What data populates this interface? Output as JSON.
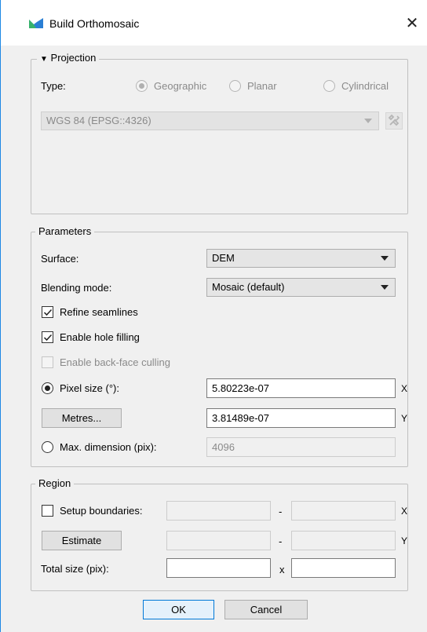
{
  "window": {
    "title": "Build Orthomosaic",
    "close_symbol": "✕",
    "accent": "#1e88e5"
  },
  "projection": {
    "group_title": "Projection",
    "collapse_symbol": "▼",
    "type_label": "Type:",
    "options": [
      "Geographic",
      "Planar",
      "Cylindrical"
    ],
    "selected": "Geographic",
    "crs_value": "WGS 84 (EPSG::4326)",
    "crs_tool_icon": "wrench-screwdriver-icon"
  },
  "parameters": {
    "group_title": "Parameters",
    "surface_label": "Surface:",
    "surface_value": "DEM",
    "blending_label": "Blending mode:",
    "blending_value": "Mosaic (default)",
    "refine_seamlines": {
      "label": "Refine seamlines",
      "checked": true
    },
    "hole_filling": {
      "label": "Enable hole filling",
      "checked": true
    },
    "back_face_culling": {
      "label": "Enable back-face culling",
      "checked": false,
      "enabled": false
    },
    "pixel_size_label": "Pixel size (°):",
    "pixel_size_x": "5.80223e-07",
    "pixel_size_y": "3.81489e-07",
    "metres_button": "Metres...",
    "max_dimension_label": "Max. dimension (pix):",
    "max_dimension_value": "4096",
    "axis_x": "X",
    "axis_y": "Y"
  },
  "region": {
    "group_title": "Region",
    "setup_boundaries_label": "Setup boundaries:",
    "estimate_button": "Estimate",
    "dash": "-",
    "total_size_label": "Total size (pix):",
    "times": "x",
    "axis_x": "X",
    "axis_y": "Y"
  },
  "footer": {
    "ok": "OK",
    "cancel": "Cancel"
  }
}
